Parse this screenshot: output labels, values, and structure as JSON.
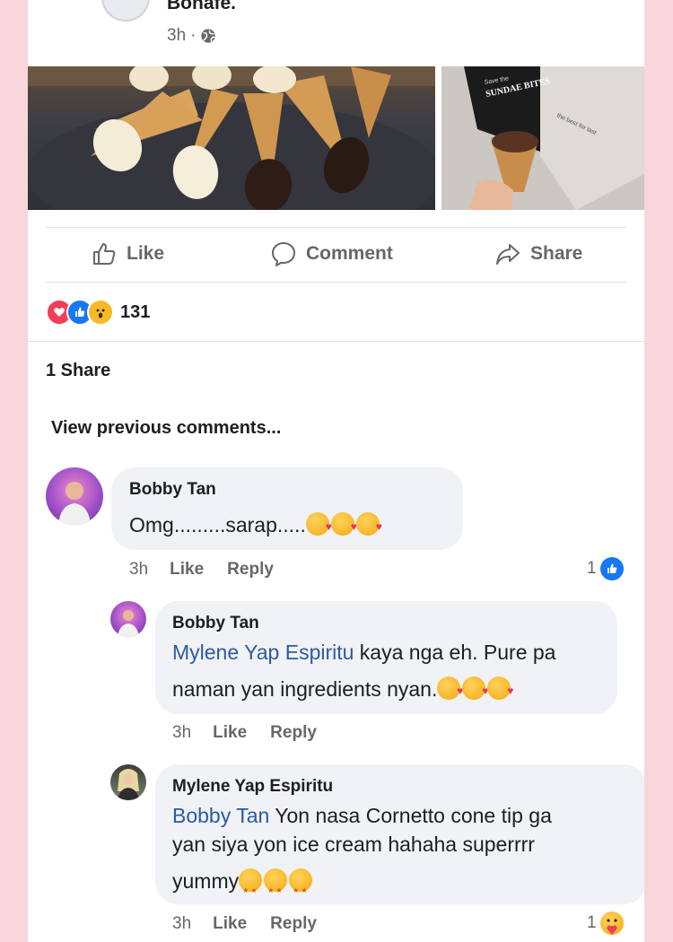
{
  "post": {
    "page_name": "Bonafe.",
    "time": "3h",
    "separator": "·"
  },
  "actions": {
    "like": "Like",
    "comment": "Comment",
    "share": "Share"
  },
  "reactions": {
    "count": "131",
    "types": [
      "love",
      "like",
      "wow"
    ]
  },
  "shares_label": "1 Share",
  "view_previous": "View previous comments...",
  "images": {
    "right_bag_text": "SUNDAE BITES",
    "right_bag_small": "Save the",
    "right_bag_side": "the best for last"
  },
  "comments": [
    {
      "author": "Bobby Tan",
      "text": "Omg.........sarap.....",
      "emojis": [
        "smiling-face-with-hearts",
        "smiling-face-with-hearts",
        "smiling-face-with-hearts"
      ],
      "time": "3h",
      "like": "Like",
      "reply": "Reply",
      "reaction_count": "1",
      "reaction_icon": "like-icon"
    }
  ],
  "replies": [
    {
      "author": "Bobby Tan",
      "mention": "Mylene Yap Espiritu",
      "line1": " kaya nga eh. Pure pa",
      "line2": "naman yan ingredients nyan.",
      "emojis": [
        "smiling-face-with-hearts",
        "smiling-face-with-hearts",
        "smiling-face-with-hearts"
      ],
      "time": "3h",
      "like": "Like",
      "reply": "Reply"
    },
    {
      "author": "Mylene Yap Espiritu",
      "mention": "Bobby Tan",
      "line1": " Yon nasa Cornetto cone tip ga",
      "line2": "yan siya yon  ice cream hahaha superrrr",
      "line3": "yummy",
      "emojis": [
        "star-struck",
        "star-struck",
        "star-struck"
      ],
      "time": "3h",
      "like": "Like",
      "reply": "Reply",
      "reaction_count": "1",
      "reaction_icon": "care-icon"
    }
  ]
}
